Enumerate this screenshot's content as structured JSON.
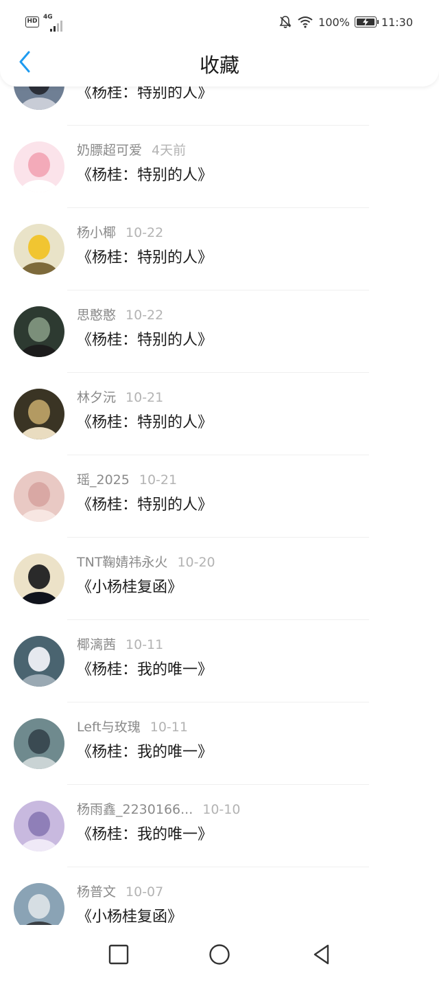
{
  "status_bar": {
    "hd": "HD",
    "network": "4G",
    "battery_percent": "100%",
    "time": "11:30"
  },
  "header": {
    "title": "收藏"
  },
  "list": [
    {
      "title": "《杨桂：特别的人》",
      "avatar_colors": [
        "#6f7f94",
        "#2b2f38",
        "#c8ccd6"
      ]
    },
    {
      "user": "奶膘超可爱",
      "time": "4天前",
      "title": "《杨桂：特别的人》",
      "avatar_colors": [
        "#fbe3ea",
        "#f3aab9",
        "#fff"
      ]
    },
    {
      "user": "杨小椰",
      "time": "10-22",
      "title": "《杨桂：特别的人》",
      "avatar_colors": [
        "#e9e3c8",
        "#f1c531",
        "#7d6a3b"
      ]
    },
    {
      "user": "思憨憨",
      "time": "10-22",
      "title": "《杨桂：特别的人》",
      "avatar_colors": [
        "#2d3a31",
        "#7b8f7a",
        "#1c1c1c"
      ]
    },
    {
      "user": "林夕沅",
      "time": "10-21",
      "title": "《杨桂：特别的人》",
      "avatar_colors": [
        "#3a3424",
        "#b39a62",
        "#e9dcc0"
      ]
    },
    {
      "user": "瑶_2025",
      "time": "10-21",
      "title": "《杨桂：特别的人》",
      "avatar_colors": [
        "#e9c9c4",
        "#d9a8a4",
        "#f7e6e2"
      ]
    },
    {
      "user": "TNT鞠婧祎永火",
      "time": "10-20",
      "title": "《小杨桂复函》",
      "avatar_colors": [
        "#ece2c8",
        "#2a2a2a",
        "#10131c"
      ]
    },
    {
      "user": "椰漓茜",
      "time": "10-11",
      "title": "《杨桂：我的唯一》",
      "avatar_colors": [
        "#4a6470",
        "#e6e9ef",
        "#9aa9b3"
      ]
    },
    {
      "user": "Left与玫瑰",
      "time": "10-11",
      "title": "《杨桂：我的唯一》",
      "avatar_colors": [
        "#6f8a8e",
        "#3a4a52",
        "#c9d3d4"
      ]
    },
    {
      "user": "杨雨鑫_2230166...",
      "time": "10-10",
      "title": "《杨桂：我的唯一》",
      "avatar_colors": [
        "#c8b9df",
        "#8f7fb8",
        "#efe9f7"
      ]
    },
    {
      "user": "杨普文",
      "time": "10-07",
      "title": "《小杨桂复函》",
      "avatar_colors": [
        "#8aa3b5",
        "#d6dee3",
        "#3a3f44"
      ]
    }
  ],
  "system_nav": {
    "icons": [
      "square-icon",
      "circle-icon",
      "triangle-back-icon"
    ]
  }
}
